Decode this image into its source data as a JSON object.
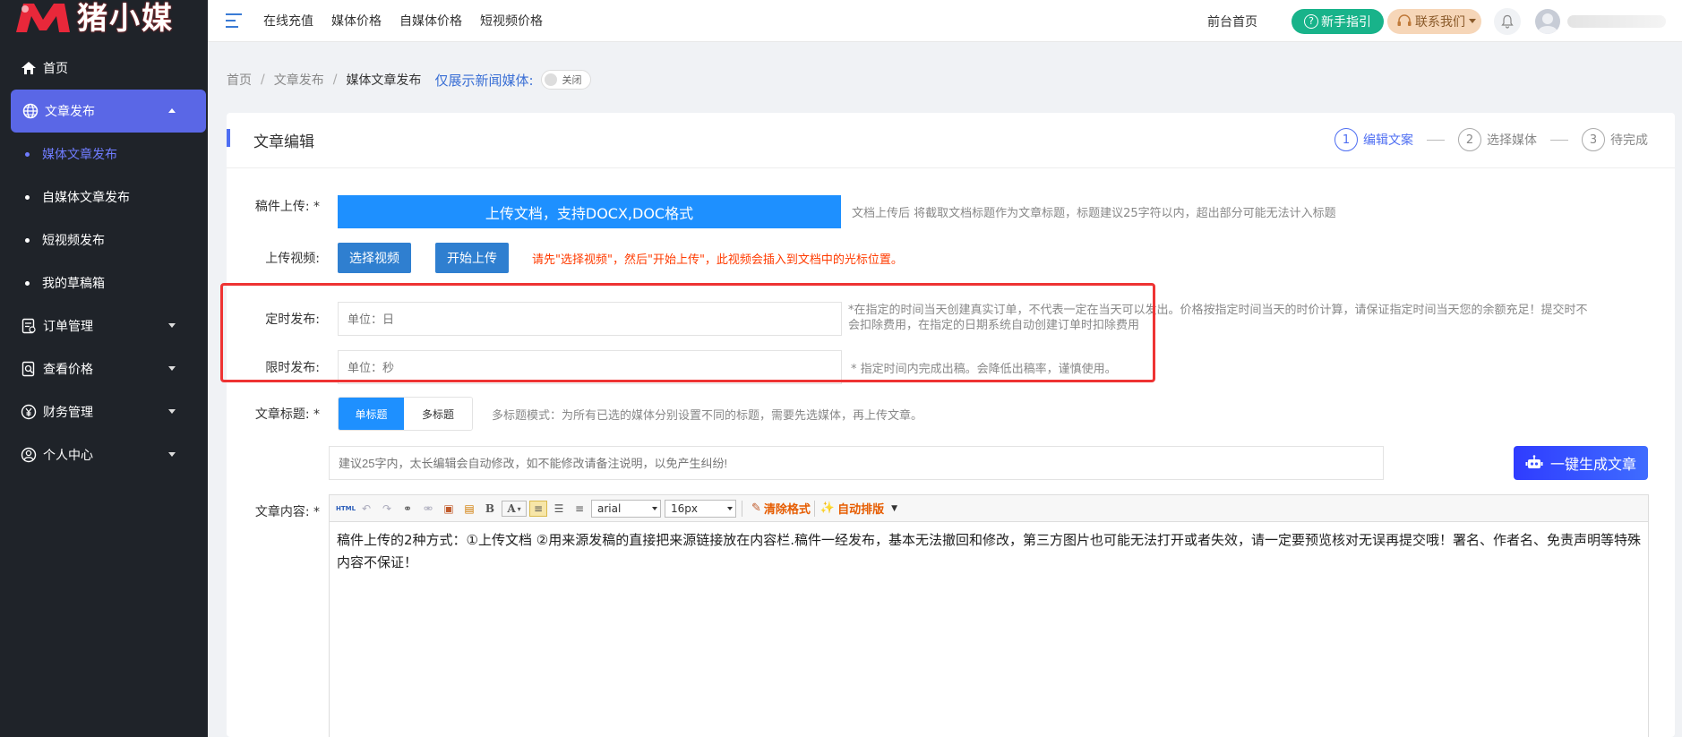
{
  "brand": {
    "logo_text": "猪小媒"
  },
  "sidebar": {
    "items": [
      {
        "label": "首页",
        "icon": "home-icon"
      },
      {
        "label": "文章发布",
        "icon": "globe-icon"
      },
      {
        "label": "订单管理",
        "icon": "order-icon"
      },
      {
        "label": "查看价格",
        "icon": "price-search-icon"
      },
      {
        "label": "财务管理",
        "icon": "finance-icon"
      },
      {
        "label": "个人中心",
        "icon": "user-icon"
      }
    ],
    "subitems": [
      "媒体文章发布",
      "自媒体文章发布",
      "短视频发布",
      "我的草稿箱"
    ]
  },
  "topnav": {
    "links": [
      "在线充值",
      "媒体价格",
      "自媒体价格",
      "短视频价格"
    ],
    "front": "前台首页",
    "guide": "新手指引",
    "contact": "联系我们"
  },
  "breadcrumb": {
    "items": [
      "首页",
      "文章发布",
      "媒体文章发布"
    ],
    "news_only": "仅展示新闻媒体:",
    "toggle": "关闭"
  },
  "card": {
    "title": "文章编辑",
    "steps": [
      {
        "n": "1",
        "label": "编辑文案"
      },
      {
        "n": "2",
        "label": "选择媒体"
      },
      {
        "n": "3",
        "label": "待完成"
      }
    ]
  },
  "form": {
    "upload_label": "稿件上传: *",
    "upload_button": "上传文档，支持DOCX,DOC格式",
    "upload_hint": "文档上传后 将截取文档标题作为文章标题，标题建议25字符以内，超出部分可能无法计入标题",
    "video_label": "上传视频:",
    "select_video": "选择视频",
    "start_upload": "开始上传",
    "video_hint": "请先\"选择视频\"，然后\"开始上传\"，此视频会插入到文档中的光标位置。",
    "timed_label": "定时发布:",
    "timed_placeholder": "单位：日",
    "timed_hint_1": "*在指定的时间当天创建真实订单，不代表一定在当天可以发出。价格按指定时间当天的时价计算，请保证指定时间当天您的余额充足！提交时不",
    "timed_hint_2": "会扣除费用，在指定的日期系统自动创建订单时扣除费用",
    "limit_label": "限时发布:",
    "limit_placeholder": "单位：秒",
    "limit_hint": "* 指定时间内完成出稿。会降低出稿率，谨慎使用。",
    "title_label": "文章标题: *",
    "single_title": "单标题",
    "multi_title": "多标题",
    "multi_hint": "多标题模式：为所有已选的媒体分别设置不同的标题，需要先选媒体，再上传文章。",
    "title_placeholder": "建议25字内，太长编辑会自动修改，如不能修改请备注说明，以免产生纠纷!",
    "ai_button": "一键生成文章",
    "content_label": "文章内容: *"
  },
  "editor": {
    "font": "arial",
    "size": "16px",
    "clear_format": "清除格式",
    "auto_layout": "自动排版",
    "content": "稿件上传的2种方式：①上传文档 ②用来源发稿的直接把来源链接放在内容栏.稿件一经发布，基本无法撤回和修改，第三方图片也可能无法打开或者失效，请一定要预览核对无误再提交哦！署名、作者名、免责声明等特殊内容不保证！"
  }
}
